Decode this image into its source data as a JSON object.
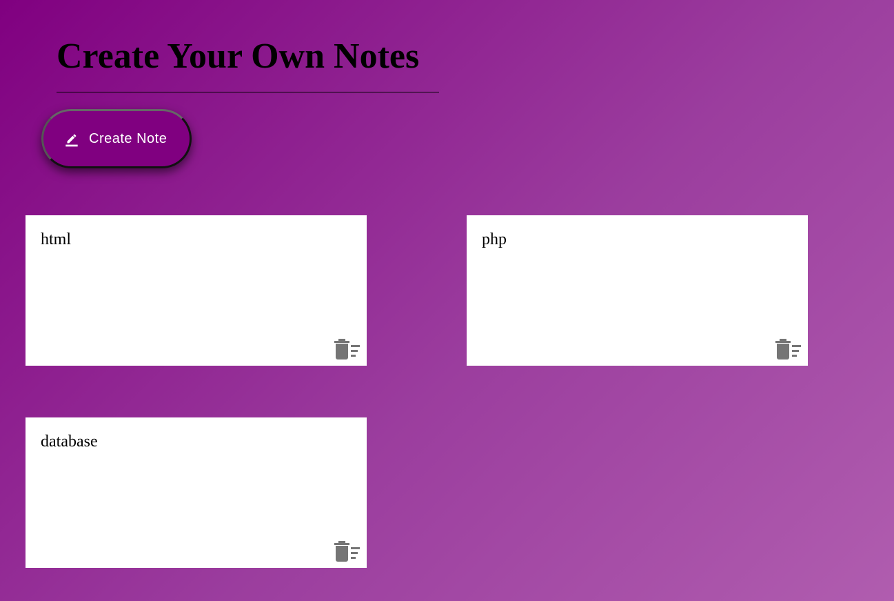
{
  "header": {
    "title": "Create Your Own Notes"
  },
  "toolbar": {
    "create_label": "Create Note",
    "create_icon": "edit-pencil-icon"
  },
  "notes": [
    {
      "text": "html",
      "delete_icon": "delete-sweep-icon"
    },
    {
      "text": "php",
      "delete_icon": "delete-sweep-icon"
    },
    {
      "text": "database",
      "delete_icon": "delete-sweep-icon"
    }
  ],
  "colors": {
    "background_start": "#800080",
    "background_end": "#b05daf",
    "button_background": "#800080",
    "note_background": "#ffffff",
    "icon_gray": "#757575"
  }
}
